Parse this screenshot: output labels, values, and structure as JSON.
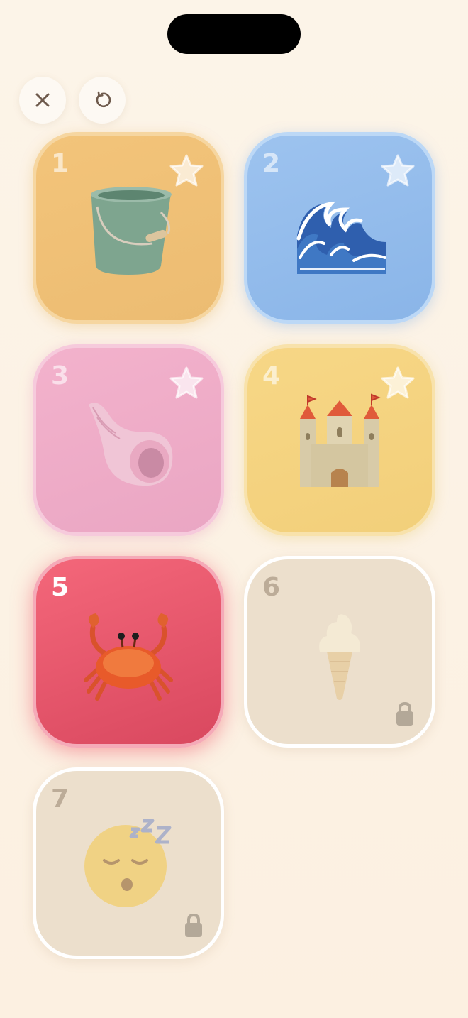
{
  "controls": {
    "close_icon": "close-icon",
    "restart_icon": "restart-icon"
  },
  "colors": {
    "background": "#fcf2e4",
    "bucket": "#f3c47a",
    "wave": "#9dc3ef",
    "shell": "#f3b2cc",
    "castle": "#f7d786",
    "crab": "#e6576c",
    "locked": "#ecdfcc"
  },
  "levels": [
    {
      "number": "1",
      "icon": "bucket-icon",
      "state": "completed",
      "star": true
    },
    {
      "number": "2",
      "icon": "wave-icon",
      "state": "completed",
      "star": true
    },
    {
      "number": "3",
      "icon": "spiral-shell-icon",
      "state": "completed",
      "star": true
    },
    {
      "number": "4",
      "icon": "sand-castle-icon",
      "state": "completed",
      "star": true
    },
    {
      "number": "5",
      "icon": "crab-icon",
      "state": "current",
      "star": false
    },
    {
      "number": "6",
      "icon": "ice-cream-icon",
      "state": "locked",
      "star": false
    },
    {
      "number": "7",
      "icon": "sleeping-face-icon",
      "state": "locked",
      "star": false
    }
  ]
}
